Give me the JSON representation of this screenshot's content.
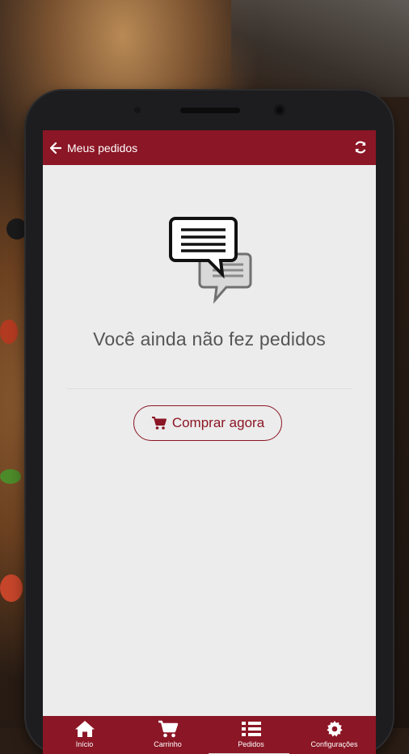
{
  "colors": {
    "accent": "#8b1625",
    "screen_bg": "#ececec",
    "text_muted": "#555555"
  },
  "appbar": {
    "back_icon": "arrow-left-icon",
    "title": "Meus pedidos",
    "refresh_icon": "refresh-icon"
  },
  "empty_state": {
    "icon": "chat-bubbles-icon",
    "message": "Você ainda não fez pedidos",
    "button_icon": "cart-icon",
    "button_label": "Comprar agora"
  },
  "bottom_nav": {
    "items": [
      {
        "label": "Início",
        "icon": "home-icon"
      },
      {
        "label": "Carrinho",
        "icon": "cart-icon"
      },
      {
        "label": "Pedidos",
        "icon": "list-icon"
      },
      {
        "label": "Configurações",
        "icon": "gear-icon"
      }
    ]
  }
}
